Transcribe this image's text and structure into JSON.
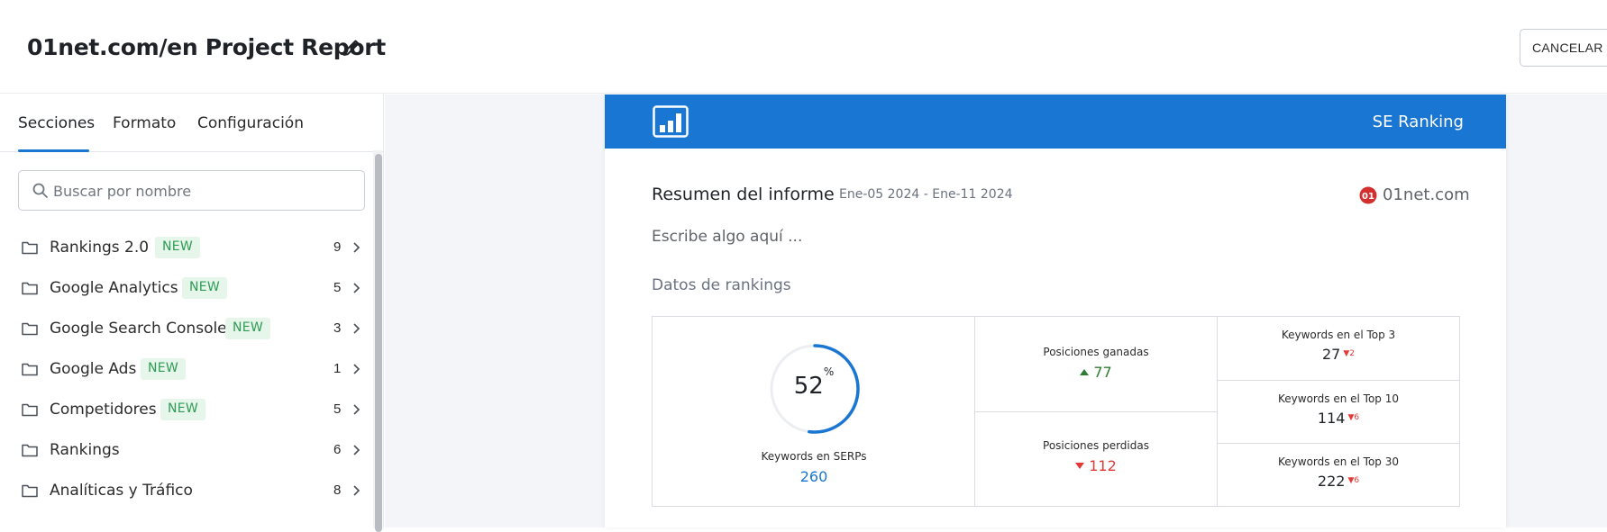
{
  "header": {
    "title": "01net.com/en Project Report",
    "cancel_label": "CANCELAR"
  },
  "sidebar": {
    "tabs": [
      {
        "label": "Secciones",
        "active": true
      },
      {
        "label": "Formato",
        "active": false
      },
      {
        "label": "Configuración",
        "active": false
      }
    ],
    "search_placeholder": "Buscar por nombre",
    "items": [
      {
        "label": "Rankings 2.0",
        "badge": "NEW",
        "count": "9"
      },
      {
        "label": "Google Analytics",
        "badge": "NEW",
        "count": "5"
      },
      {
        "label": "Google Search Console",
        "badge": "NEW",
        "count": "3"
      },
      {
        "label": "Google Ads",
        "badge": "NEW",
        "count": "1"
      },
      {
        "label": "Competidores",
        "badge": "NEW",
        "count": "5"
      },
      {
        "label": "Rankings",
        "badge": "",
        "count": "6"
      },
      {
        "label": "Analíticas y Tráfico",
        "badge": "",
        "count": "8"
      }
    ]
  },
  "report": {
    "brand": "SE Ranking",
    "summary_title": "Resumen del informe",
    "date_range": "Ene-05 2024 - Ene-11 2024",
    "site_name": "01net.com",
    "site_logo_text": "01",
    "placeholder": "Escribe algo aquí ...",
    "section_title": "Datos de rankings",
    "serps": {
      "percent": "52",
      "percent_symbol": "%",
      "percent_fraction": 0.52,
      "label": "Keywords en SERPs",
      "value": "260"
    },
    "gained": {
      "label": "Posiciones ganadas",
      "value": "77"
    },
    "lost": {
      "label": "Posiciones perdidas",
      "value": "112"
    },
    "top3": {
      "label": "Keywords en el Top 3",
      "value": "27",
      "delta": "2"
    },
    "top10": {
      "label": "Keywords en el Top 10",
      "value": "114",
      "delta": "6"
    },
    "top30": {
      "label": "Keywords en el Top 30",
      "value": "222",
      "delta": "6"
    }
  },
  "colors": {
    "accent": "#1976d2",
    "badge_bg": "#e6f6ea",
    "badge_text": "#2e9b55",
    "positive": "#2e7d32",
    "negative": "#e53935",
    "site_logo": "#d32f2f"
  }
}
